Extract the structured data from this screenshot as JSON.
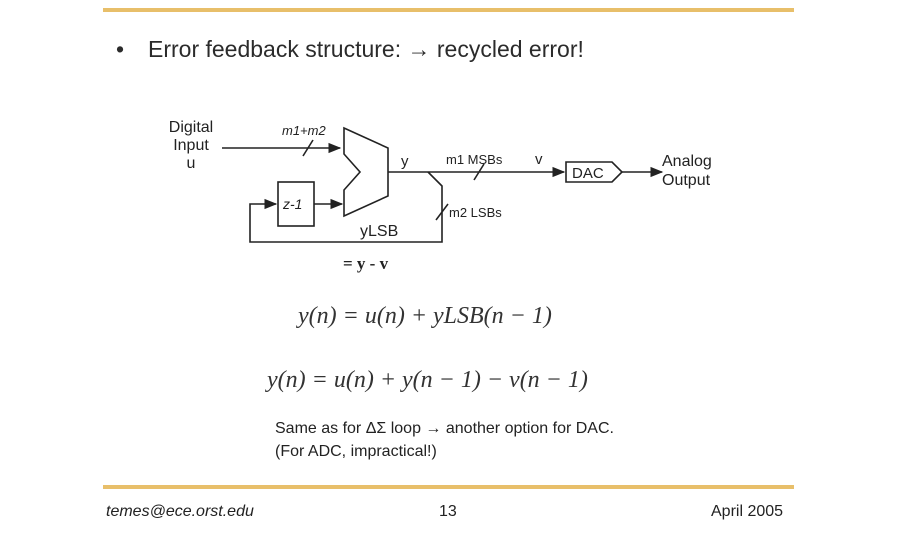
{
  "bullet": {
    "symbol": "•",
    "text": "Error feedback structure: → recycled error!"
  },
  "diagram": {
    "input_label_line1": "Digital",
    "input_label_line2": "Input",
    "input_label_line3": "u",
    "input_bits": "m1+m2",
    "quantizer_output_label": "y",
    "msb_bits_label": "m1 MSBs",
    "msb_output_label": "v",
    "dac_label": "DAC",
    "output_label_line1": "Analog",
    "output_label_line2": "Output",
    "delay_label": "z-1",
    "lsb_bits_label": "m2 LSBs",
    "lsb_signal_label": "yLSB",
    "lsb_definition": "= y - v"
  },
  "equations": {
    "eq1": "y(n) = u(n) + yLSB(n − 1)",
    "eq2": "y(n) = u(n) + y(n − 1) − v(n − 1)"
  },
  "notes": {
    "line1": "Same as for ΔΣ loop → another option for DAC.",
    "line2": "(For ADC, impractical!)"
  },
  "footer": {
    "email": "temes@ece.orst.edu",
    "page": "13",
    "date": "April 2005"
  },
  "colors": {
    "rule": "#e8bf6a",
    "line": "#222222"
  }
}
